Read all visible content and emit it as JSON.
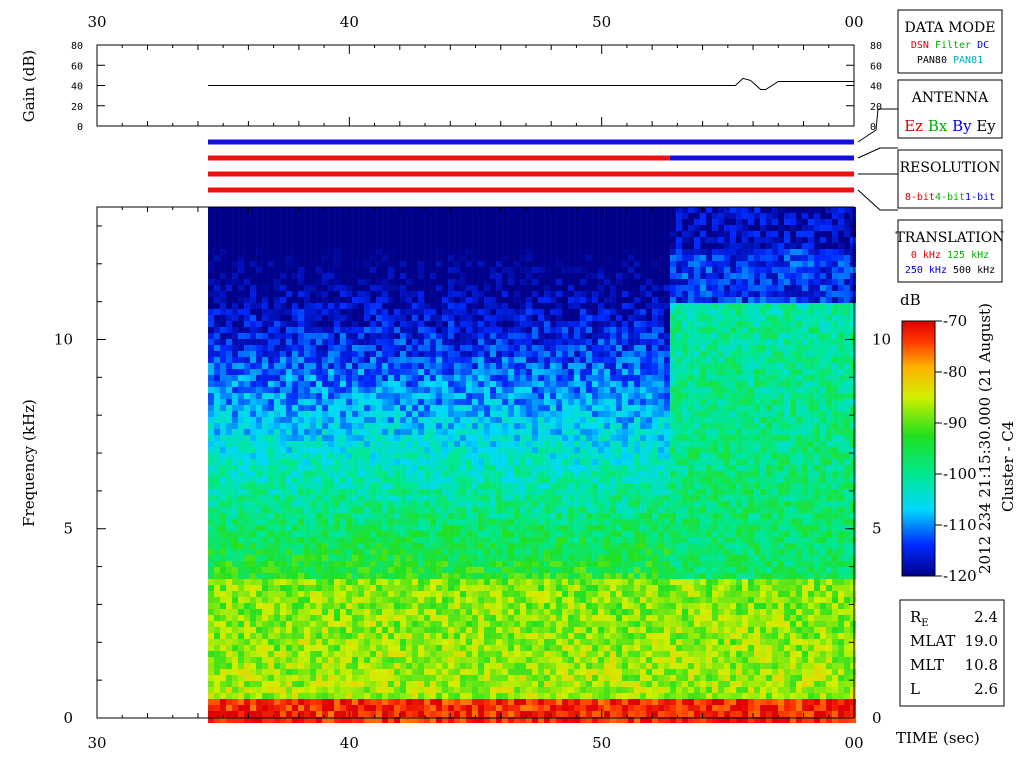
{
  "chart_data": [
    {
      "type": "line",
      "name": "gain",
      "ylabel": "Gain (dB)",
      "y_ticks": [
        "0",
        "20",
        "40",
        "60",
        "80"
      ],
      "ylim": [
        0,
        80
      ],
      "x_ticks": [
        "30",
        "40",
        "50",
        "00"
      ],
      "x": [
        34.4,
        55.3,
        55.6,
        55.9,
        56.3,
        56.5,
        57.0,
        60.0
      ],
      "y": [
        40,
        40,
        47,
        45,
        36,
        36,
        44,
        44
      ]
    },
    {
      "type": "heatmap",
      "name": "spectrogram",
      "ylabel": "Frequency (kHz)",
      "xlabel": "TIME (sec)",
      "x_ticks": [
        "30",
        "40",
        "50",
        "00"
      ],
      "y_ticks": [
        "0",
        "5",
        "10"
      ],
      "ylim": [
        0,
        13.5
      ],
      "xlim": [
        30,
        60
      ],
      "data_start": 34.4,
      "colorbar": {
        "label": "dB",
        "ticks": [
          "-70",
          "-80",
          "-90",
          "-100",
          "-110",
          "-120"
        ],
        "range": [
          -120,
          -70
        ]
      }
    }
  ],
  "timestamp": "2012 234 21:15:30.000 (21 August)",
  "spacecraft": "Cluster - C4",
  "status_bars": [
    {
      "segments": [
        {
          "from": 34.4,
          "to": 60,
          "color": "#1010e0"
        }
      ]
    },
    {
      "segments": [
        {
          "from": 34.4,
          "to": 52.7,
          "color": "#f01010"
        },
        {
          "from": 52.7,
          "to": 60,
          "color": "#1010e0"
        }
      ]
    },
    {
      "segments": [
        {
          "from": 34.4,
          "to": 60,
          "color": "#f01010"
        }
      ]
    },
    {
      "segments": [
        {
          "from": 34.4,
          "to": 60,
          "color": "#f01010"
        }
      ]
    }
  ],
  "legend_boxes": {
    "data_mode": {
      "title": "DATA MODE",
      "row1": [
        {
          "text": "DSN",
          "color": "#e00000"
        },
        {
          "text": "Filter",
          "color": "#00b000"
        },
        {
          "text": "DC",
          "color": "#0000e0"
        }
      ],
      "row2": [
        {
          "text": "PAN80",
          "color": "#000000"
        },
        {
          "text": "PAN81",
          "color": "#00b0c0"
        }
      ]
    },
    "antenna": {
      "title": "ANTENNA",
      "row1": [
        {
          "text": "Ez",
          "color": "#e00000"
        },
        {
          "text": "Bx",
          "color": "#00b000"
        },
        {
          "text": "By",
          "color": "#0000e0"
        },
        {
          "text": "Ey",
          "color": "#000000"
        }
      ]
    },
    "resolution": {
      "title": "RESOLUTION",
      "row1": [
        {
          "text": "8-bit",
          "color": "#e00000"
        },
        {
          "text": "4-bit",
          "color": "#00b000"
        },
        {
          "text": "1-bit",
          "color": "#0000e0"
        }
      ]
    },
    "translation": {
      "title": "TRANSLATION",
      "row1": [
        {
          "text": "0 kHz",
          "color": "#e00000"
        },
        {
          "text": "125 kHz",
          "color": "#00b000"
        }
      ],
      "row2": [
        {
          "text": "250 kHz",
          "color": "#0000e0"
        },
        {
          "text": "500 kHz",
          "color": "#000000"
        }
      ]
    }
  },
  "orbit_info": [
    {
      "label": "R",
      "sub": "E",
      "value": "2.4"
    },
    {
      "label": "MLAT",
      "sub": "",
      "value": "19.0"
    },
    {
      "label": "MLT",
      "sub": "",
      "value": "10.8"
    },
    {
      "label": "L",
      "sub": "",
      "value": "2.6"
    }
  ]
}
